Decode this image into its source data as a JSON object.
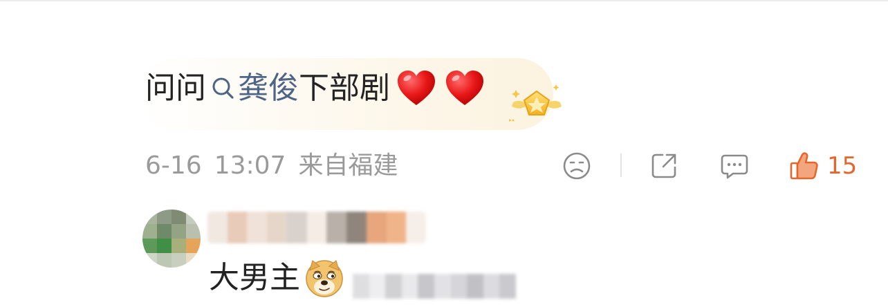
{
  "comment": {
    "text_prefix": "问问",
    "topic": "龚俊",
    "text_suffix": "下部剧",
    "emoji": [
      "heart-emoji",
      "heart-emoji"
    ]
  },
  "meta": {
    "date": "6-16",
    "time": "13:07",
    "location": "来自福建"
  },
  "actions": {
    "like_count": "15",
    "icons": [
      "frown-icon",
      "share-icon",
      "comment-icon",
      "thumbs-up-icon"
    ]
  },
  "reply": {
    "text": "大男主",
    "emoji": "doge-emoji"
  },
  "colors": {
    "topic_link": "#4d6485",
    "meta_text": "#9a9a9a",
    "like_accent": "#e4662d",
    "icon_gray": "#8a8a8a"
  }
}
